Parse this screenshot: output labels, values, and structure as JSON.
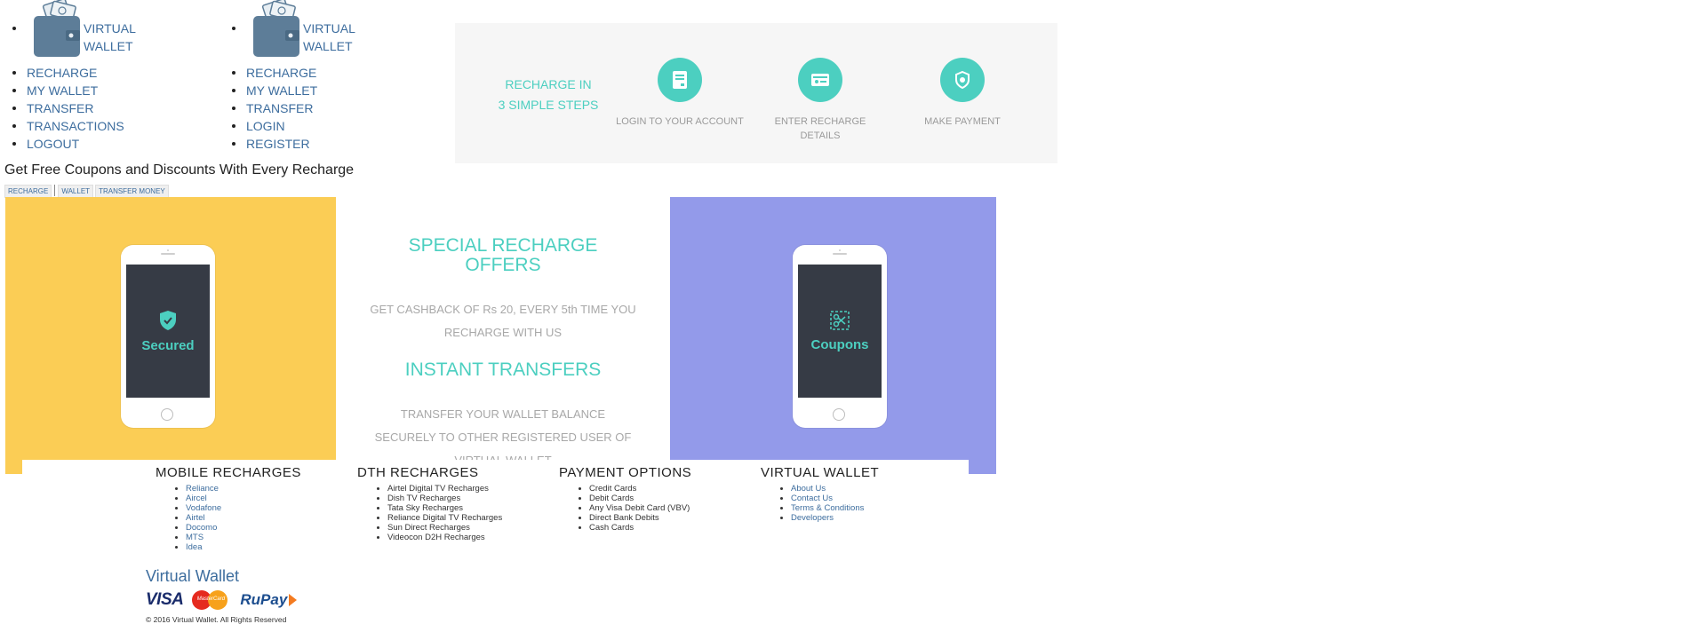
{
  "colors": {
    "accent": "#4ccfc0",
    "link": "#3d6d9e",
    "banner_yellow": "#fbcd55",
    "banner_purple": "#939aea",
    "phone_screen": "#363b45",
    "steps_background": "#f6f6f6"
  },
  "nav_left": {
    "brand": "VIRTUAL WALLET",
    "logo_icon": "wallet-logo",
    "items": [
      "RECHARGE",
      "MY WALLET",
      "TRANSFER",
      "TRANSACTIONS",
      "LOGOUT"
    ]
  },
  "nav_right": {
    "brand": "VIRTUAL WALLET",
    "logo_icon": "wallet-logo",
    "items": [
      "RECHARGE",
      "MY WALLET",
      "TRANSFER",
      "LOGIN",
      "REGISTER"
    ]
  },
  "steps": {
    "heading_line1": "RECHARGE IN",
    "heading_line2": "3 SIMPLE STEPS",
    "items": [
      {
        "label_line1": "LOGIN TO YOUR ACCOUNT",
        "label_line2": "",
        "icon": "account-card-icon"
      },
      {
        "label_line1": "ENTER RECHARGE",
        "label_line2": "DETAILS",
        "icon": "recharge-card-icon"
      },
      {
        "label_line1": "MAKE PAYMENT",
        "label_line2": "",
        "icon": "payment-shield-icon"
      }
    ]
  },
  "promo_heading": "Get Free Coupons and Discounts With Every Recharge",
  "tabs": [
    "RECHARGE",
    "WALLET",
    "TRANSFER MONEY"
  ],
  "banner": {
    "left_phone_text": "Secured",
    "left_phone_icon": "shield-check-icon",
    "right_phone_text": "Coupons",
    "right_phone_icon": "scissors-coupon-icon",
    "offer1_title_line1": "SPECIAL RECHARGE",
    "offer1_title_line2": "OFFERS",
    "offer1_text_line1": "GET CASHBACK OF Rs 20, EVERY 5th TIME YOU",
    "offer1_text_line2": "RECHARGE WITH US",
    "offer2_title": "INSTANT TRANSFERS",
    "offer2_text_line1": "TRANSFER YOUR WALLET BALANCE",
    "offer2_text_line2": "SECURELY TO OTHER REGISTERED USER OF",
    "offer2_text_line3": "VIRTUAL WALLET"
  },
  "footer": {
    "columns": [
      {
        "heading": "MOBILE RECHARGES",
        "links": true,
        "items": [
          "Reliance",
          "Aircel",
          "Vodafone",
          "Airtel",
          "Docomo",
          "MTS",
          "Idea"
        ]
      },
      {
        "heading": "DTH RECHARGES",
        "links": false,
        "items": [
          "Airtel Digital TV Recharges",
          "Dish TV Recharges",
          "Tata Sky Recharges",
          "Reliance Digital TV Recharges",
          "Sun Direct Recharges",
          "Videocon D2H Recharges"
        ]
      },
      {
        "heading": "PAYMENT OPTIONS",
        "links": false,
        "items": [
          "Credit Cards",
          "Debit Cards",
          "Any Visa Debit Card (VBV)",
          "Direct Bank Debits",
          "Cash Cards"
        ]
      },
      {
        "heading": "VIRTUAL WALLET",
        "links": true,
        "items": [
          "About Us",
          "Contact Us",
          "Terms & Conditions",
          "Developers"
        ]
      }
    ],
    "brand": "Virtual Wallet",
    "payment_logos": {
      "visa": "VISA",
      "mastercard": "MasterCard",
      "rupay": "RuPay"
    },
    "copyright": "© 2016 Virtual Wallet. All Rights Reserved"
  }
}
